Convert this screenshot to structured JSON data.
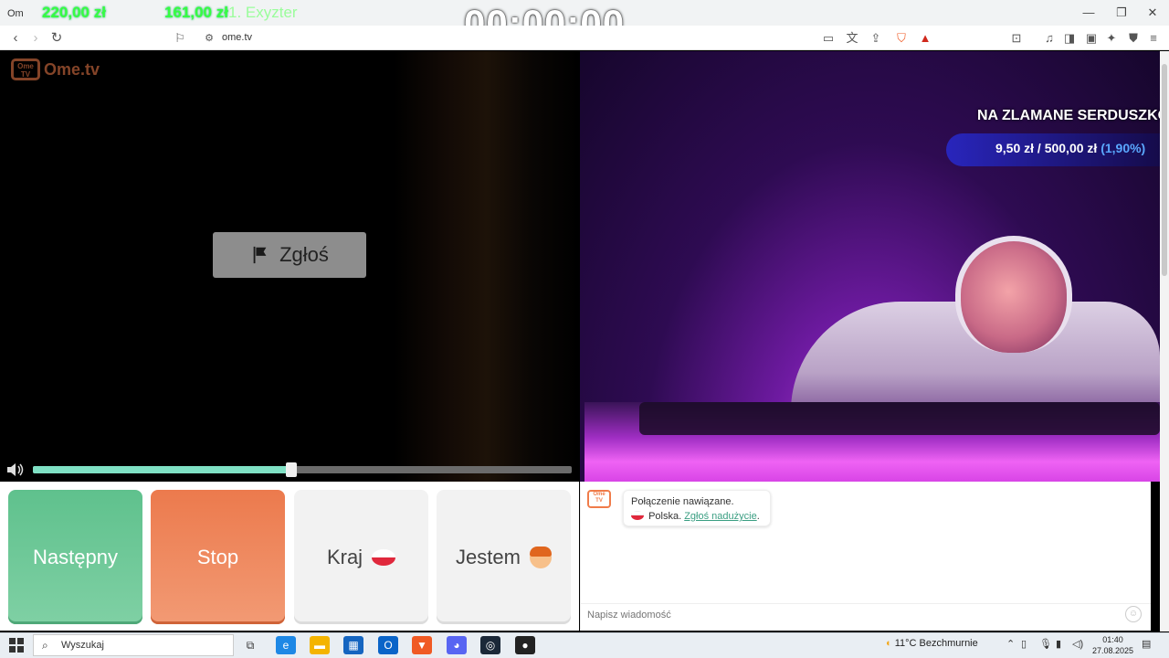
{
  "browser": {
    "tab_title": "Om",
    "url": "ome.tv",
    "window_controls": [
      "minimize",
      "restore",
      "close"
    ]
  },
  "stream_overlay": {
    "top_money_a": "220,00 zł",
    "top_money_b": "161,00 zł",
    "top_label": "1. Exyzter",
    "timer": "00:00:00",
    "goal_title": "NA ZLAMANE SERDUSZKO 💔",
    "goal_current": "9,50 zł",
    "goal_separator": "/",
    "goal_target": "500,00 zł",
    "goal_percent": "(1,90%)"
  },
  "app": {
    "logo_text": "Ome.tv",
    "logo_badge": "Ome TV",
    "report_label": "Zgłoś",
    "volume_level": 0.48
  },
  "controls": {
    "next_label": "Następny",
    "stop_label": "Stop",
    "country_label": "Kraj",
    "gender_label": "Jestem"
  },
  "chat": {
    "status": "Połączenie nawiązane.",
    "country": "Polska.",
    "report_link": "Zgłoś nadużycie",
    "input_placeholder": "Napisz wiadomość"
  },
  "taskbar": {
    "search_placeholder": "Wyszukaj",
    "weather_temp": "11°C",
    "weather_desc": "Bezchmurnie",
    "time": "01:40",
    "date": "27.08.2025"
  },
  "colors": {
    "accent_green": "#5fc18d",
    "accent_orange": "#ec7a4d",
    "link_green": "#3a9e82",
    "overlay_green": "#35ff40"
  }
}
